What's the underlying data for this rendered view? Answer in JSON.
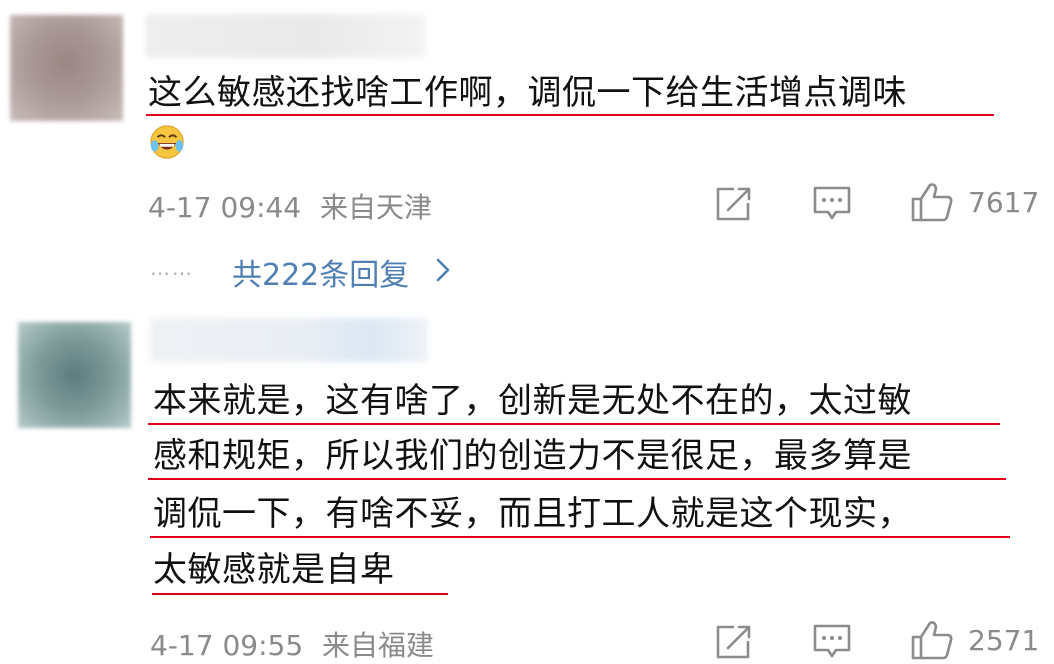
{
  "comments": [
    {
      "text_lines": [
        "这么敏感还找啥工作啊，调侃一下给生活增点调味"
      ],
      "emoji": "laughing-tears-emoji",
      "time": "4-17 09:44",
      "location": "来自天津",
      "likes": "7617",
      "replies_link": "共222条回复",
      "replies_dots": "……"
    },
    {
      "text_lines": [
        "本来就是，这有啥了，创新是无处不在的，太过敏",
        "感和规矩，所以我们的创造力不是很足，最多算是",
        "调侃一下，有啥不妥，而且打工人就是这个现实，",
        "太敏感就是自卑"
      ],
      "time": "4-17 09:55",
      "location": "来自福建",
      "likes": "2571"
    }
  ],
  "colors": {
    "underline": "#e0001b",
    "meta_gray": "#8a8a8a",
    "link_blue": "#4f7fb3",
    "icon_gray": "#8c8c8c"
  }
}
